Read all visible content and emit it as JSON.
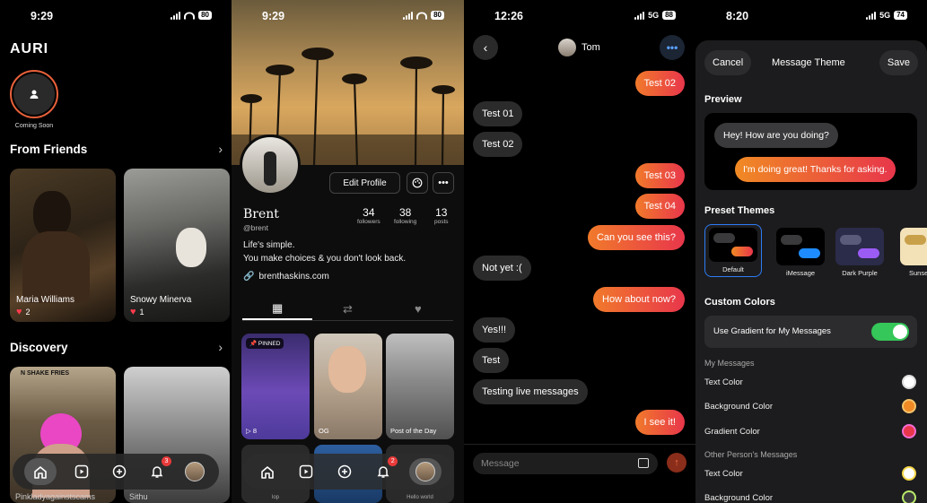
{
  "colors": {
    "accent_orange": "#f17a2b",
    "accent_red": "#e8364b",
    "green": "#35c759"
  },
  "feed": {
    "time": "9:29",
    "battery": "80",
    "brand": "AURI",
    "story_label": "Coming Soon",
    "section_friends": "From Friends",
    "section_discovery": "Discovery",
    "cards": [
      {
        "name": "Maria Williams",
        "likes": "2"
      },
      {
        "name": "Snowy Minerva",
        "likes": "1"
      }
    ],
    "discovery": [
      {
        "caption": "N SHAKE FRIES",
        "user": "Pinkladyagainstscams"
      },
      {
        "user": "Sithu"
      }
    ],
    "nav_badge": "3"
  },
  "profile": {
    "time": "9:29",
    "battery": "80",
    "name": "Brent",
    "handle": "@brent",
    "edit_label": "Edit Profile",
    "stats": [
      {
        "n": "34",
        "l": "followers"
      },
      {
        "n": "38",
        "l": "following"
      },
      {
        "n": "13",
        "l": "posts"
      }
    ],
    "bio1": "Life's simple.",
    "bio2": "You make choices & you don't look back.",
    "link": "brenthaskins.com",
    "pinned": "PINNED",
    "tile1_views": "8",
    "tile2_caption": "OG",
    "tile3_caption": "Post of the Day",
    "nav_badge": "2",
    "tile_bottom_left": "lop",
    "tile_bottom_right": "Hello world"
  },
  "chat": {
    "time": "12:26",
    "network": "5G",
    "battery": "88",
    "contact": "Tom",
    "messages": [
      {
        "from": "me",
        "text": "Test 02"
      },
      {
        "from": "them",
        "text": "Test 01"
      },
      {
        "from": "them",
        "text": "Test 02"
      },
      {
        "from": "me",
        "text": "Test 03"
      },
      {
        "from": "me",
        "text": "Test 04"
      },
      {
        "from": "me",
        "text": "Can you see this?"
      },
      {
        "from": "them",
        "text": "Not yet :("
      },
      {
        "from": "me",
        "text": "How about now?"
      },
      {
        "from": "them",
        "text": "Yes!!!"
      },
      {
        "from": "them",
        "text": "Test"
      },
      {
        "from": "them",
        "text": "Testing live messages"
      },
      {
        "from": "me",
        "text": "I see it!"
      }
    ],
    "placeholder": "Message"
  },
  "theme": {
    "time": "8:20",
    "network": "5G",
    "battery": "74",
    "cancel": "Cancel",
    "title": "Message Theme",
    "save": "Save",
    "preview_label": "Preview",
    "preview_them": "Hey! How are you doing?",
    "preview_me": "I'm doing great! Thanks for asking.",
    "preset_label": "Preset Themes",
    "presets": [
      "Default",
      "iMessage",
      "Dark Purple",
      "Sunset"
    ],
    "custom_label": "Custom Colors",
    "gradient_toggle": "Use Gradient for My Messages",
    "my_messages": "My Messages",
    "my_rows": [
      "Text Color",
      "Background Color",
      "Gradient Color"
    ],
    "other_messages": "Other Person's Messages",
    "other_rows": [
      "Text Color",
      "Background Color"
    ]
  }
}
